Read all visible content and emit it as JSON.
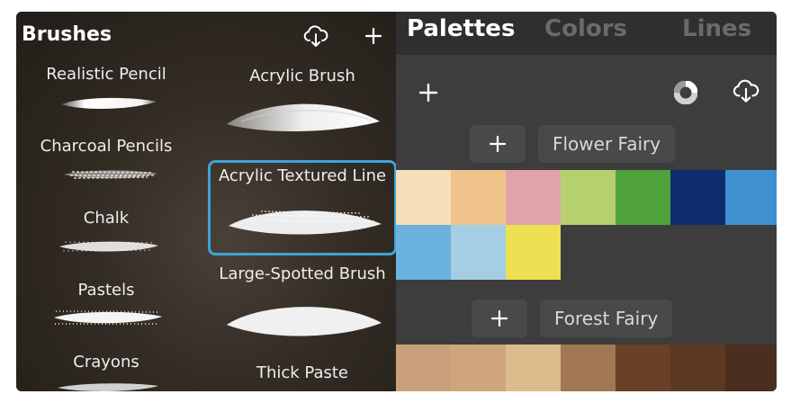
{
  "brushes": {
    "title": "Brushes",
    "left_column": [
      "Realistic Pencil",
      "Charcoal Pencils",
      "Chalk",
      "Pastels",
      "Crayons"
    ],
    "right_column": [
      "Acrylic Brush",
      "Acrylic Textured Line",
      "Large-Spotted Brush",
      "Thick Paste"
    ],
    "selected": "Acrylic Textured Line",
    "icons": [
      "cloud-download-icon",
      "plus-icon"
    ]
  },
  "palettes": {
    "tabs": [
      {
        "label": "Palettes",
        "active": true
      },
      {
        "label": "Colors",
        "active": false
      },
      {
        "label": "Lines",
        "active": false
      }
    ],
    "toolbar_icons": [
      "plus-icon",
      "color-wheel-icon",
      "cloud-download-icon"
    ],
    "groups": [
      {
        "name": "Flower Fairy",
        "colors": [
          "#f4dfb9",
          "#f0c38c",
          "#e1a2aa",
          "#b7d06e",
          "#4fa13c",
          "#0e2c6b",
          "#3f8fd1",
          "#6bb2de",
          "#a4cee3",
          "#ede052"
        ]
      },
      {
        "name": "Forest Fairy",
        "colors": [
          "#c9a079",
          "#cfa67c",
          "#dcbb8c",
          "#a27754",
          "#6a4028",
          "#5b3923",
          "#4a2f1e"
        ]
      }
    ],
    "accent": "#3da3d8"
  }
}
